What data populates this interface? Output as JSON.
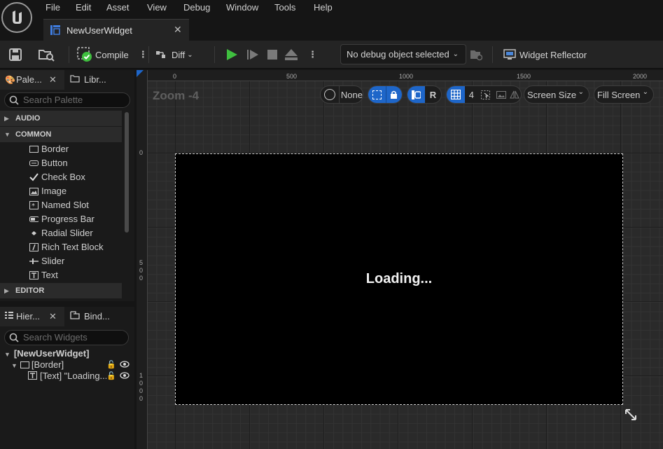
{
  "menu": [
    "File",
    "Edit",
    "Asset",
    "View",
    "Debug",
    "Window",
    "Tools",
    "Help"
  ],
  "document_tab": {
    "title": "NewUserWidget"
  },
  "toolbar": {
    "compile_label": "Compile",
    "diff_label": "Diff",
    "debug_object": "No debug object selected",
    "widget_reflector_label": "Widget Reflector"
  },
  "palette": {
    "tab_palette": "Pale...",
    "tab_library": "Libr...",
    "search_placeholder": "Search Palette",
    "categories": {
      "audio": "AUDIO",
      "common": "COMMON",
      "editor": "EDITOR"
    },
    "items": [
      "Border",
      "Button",
      "Check Box",
      "Image",
      "Named Slot",
      "Progress Bar",
      "Radial Slider",
      "Rich Text Block",
      "Slider",
      "Text"
    ]
  },
  "hierarchy": {
    "tab_hierarchy": "Hier...",
    "tab_bindings": "Bind...",
    "search_placeholder": "Search Widgets",
    "root": "[NewUserWidget]",
    "border": "[Border]",
    "text": "[Text] \"Loading..."
  },
  "viewport": {
    "zoom_label": "Zoom -4",
    "localization": "None",
    "r_label": "R",
    "grid_snap": "4",
    "screen_size": "Screen Size",
    "fill_screen": "Fill Screen",
    "ruler_top": [
      "0",
      "500",
      "1000",
      "1500",
      "2000"
    ],
    "ruler_left": [
      "0",
      "500",
      "1000"
    ],
    "canvas_text": "Loading..."
  },
  "colors": {
    "accent_blue": "#1e66c9",
    "play_green": "#3fbf3f",
    "canvas_bg": "#000000"
  }
}
